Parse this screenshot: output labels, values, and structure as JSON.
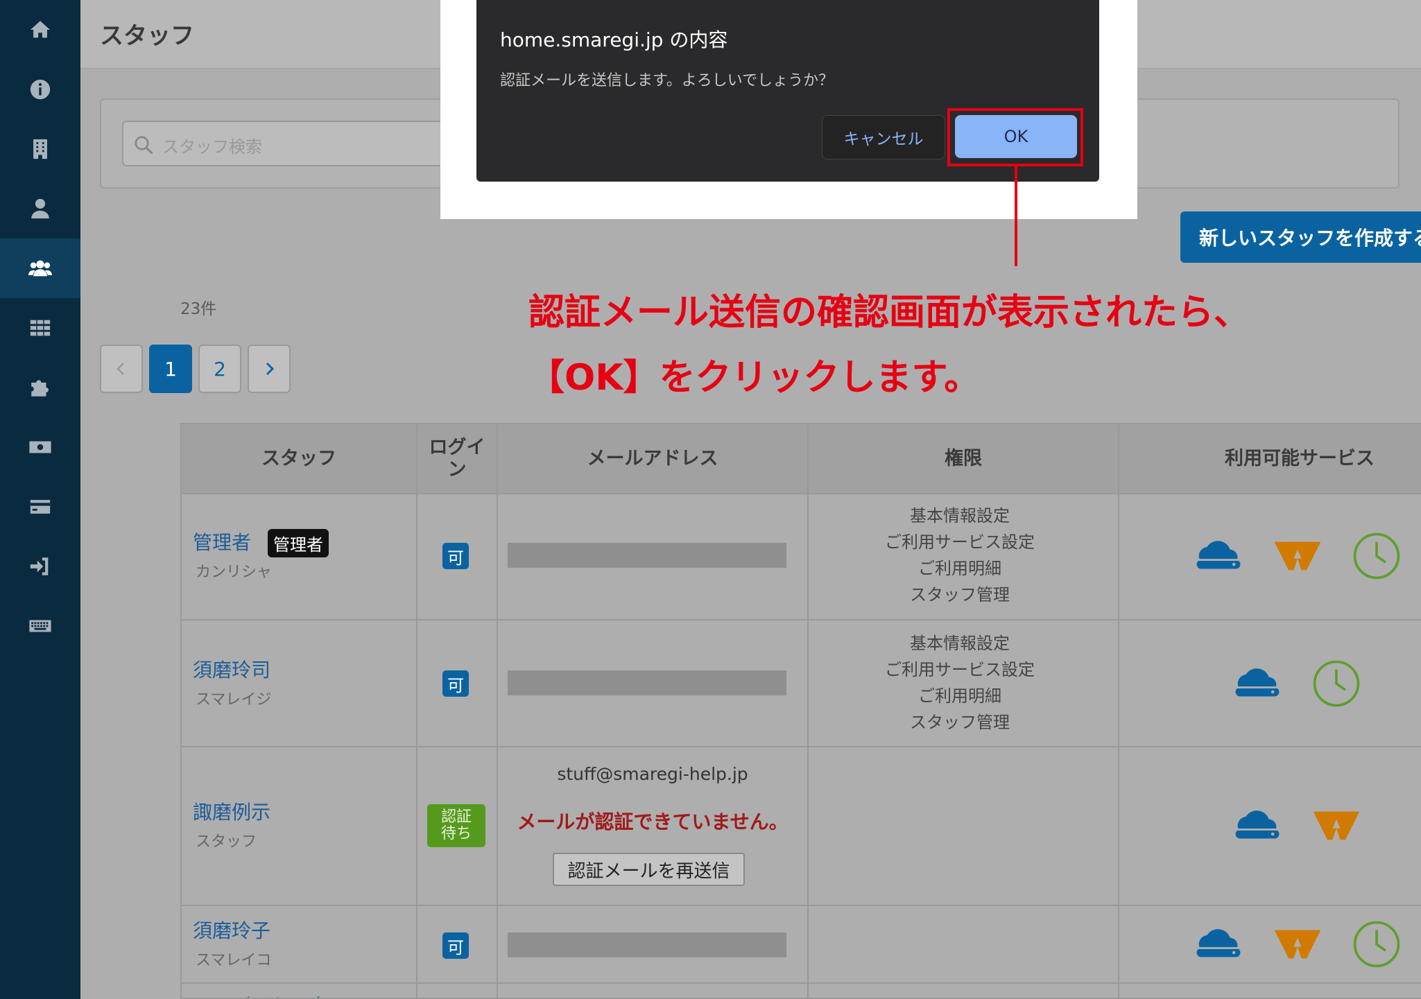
{
  "sidebar": {
    "items": [
      {
        "icon": "home-icon"
      },
      {
        "icon": "info-icon"
      },
      {
        "icon": "building-icon"
      },
      {
        "icon": "user-icon"
      },
      {
        "icon": "users-icon",
        "active": true
      },
      {
        "icon": "grid-icon"
      },
      {
        "icon": "puzzle-icon"
      },
      {
        "icon": "money-icon"
      },
      {
        "icon": "credit-card-icon"
      },
      {
        "icon": "sign-in-icon"
      },
      {
        "icon": "keyboard-icon"
      }
    ]
  },
  "header": {
    "title": "スタッフ"
  },
  "search": {
    "placeholder": "スタッフ検索"
  },
  "dialog": {
    "title": "home.smaregi.jp の内容",
    "message": "認証メールを送信します。よろしいでしょうか？",
    "cancel_label": "キャンセル",
    "ok_label": "OK"
  },
  "annotation": {
    "line1": "認証メール送信の確認画面が表示されたら、",
    "line2": "【OK】をクリックします。"
  },
  "create_button": {
    "label": "新しいスタッフを作成する",
    "icon": "plus-icon"
  },
  "count": "23件",
  "pagination": {
    "pages": [
      "1",
      "2"
    ],
    "current": "1"
  },
  "table": {
    "headers": {
      "staff": "スタッフ",
      "login_line1": "ログイ",
      "login_line2": "ン",
      "email": "メールアドレス",
      "permission": "権限",
      "services": "利用可能サービス"
    },
    "rows": [
      {
        "name": "管理者",
        "kana": "カンリシャ",
        "badge": "管理者",
        "login": "可",
        "perms": [
          "基本情報設定",
          "ご利用サービス設定",
          "ご利用明細",
          "スタッフ管理"
        ],
        "services": [
          "cloud-icon",
          "waiter-icon",
          "clock-icon"
        ]
      },
      {
        "name": "須磨玲司",
        "kana": "スマレイジ",
        "login": "可",
        "perms": [
          "基本情報設定",
          "ご利用サービス設定",
          "ご利用明細",
          "スタッフ管理"
        ],
        "services": [
          "cloud-icon",
          "clock-icon"
        ]
      },
      {
        "name": "諏磨例示",
        "kana": "スタッフ",
        "login_pending_line1": "認証",
        "login_pending_line2": "待ち",
        "email": "stuff@smaregi-help.jp",
        "warning": "メールが認証できていません。",
        "resend_label": "認証メールを再送信",
        "services": [
          "cloud-icon",
          "waiter-icon"
        ]
      },
      {
        "name": "須磨玲子",
        "kana": "スマレイコ",
        "login": "可",
        "services": [
          "cloud-icon",
          "waiter-icon",
          "clock-icon"
        ]
      },
      {
        "name": "アルバイトスタッフ"
      }
    ]
  },
  "colors": {
    "sidebar": "#0a2a3f",
    "accent": "#0a63a0",
    "annotation": "#e60012"
  }
}
